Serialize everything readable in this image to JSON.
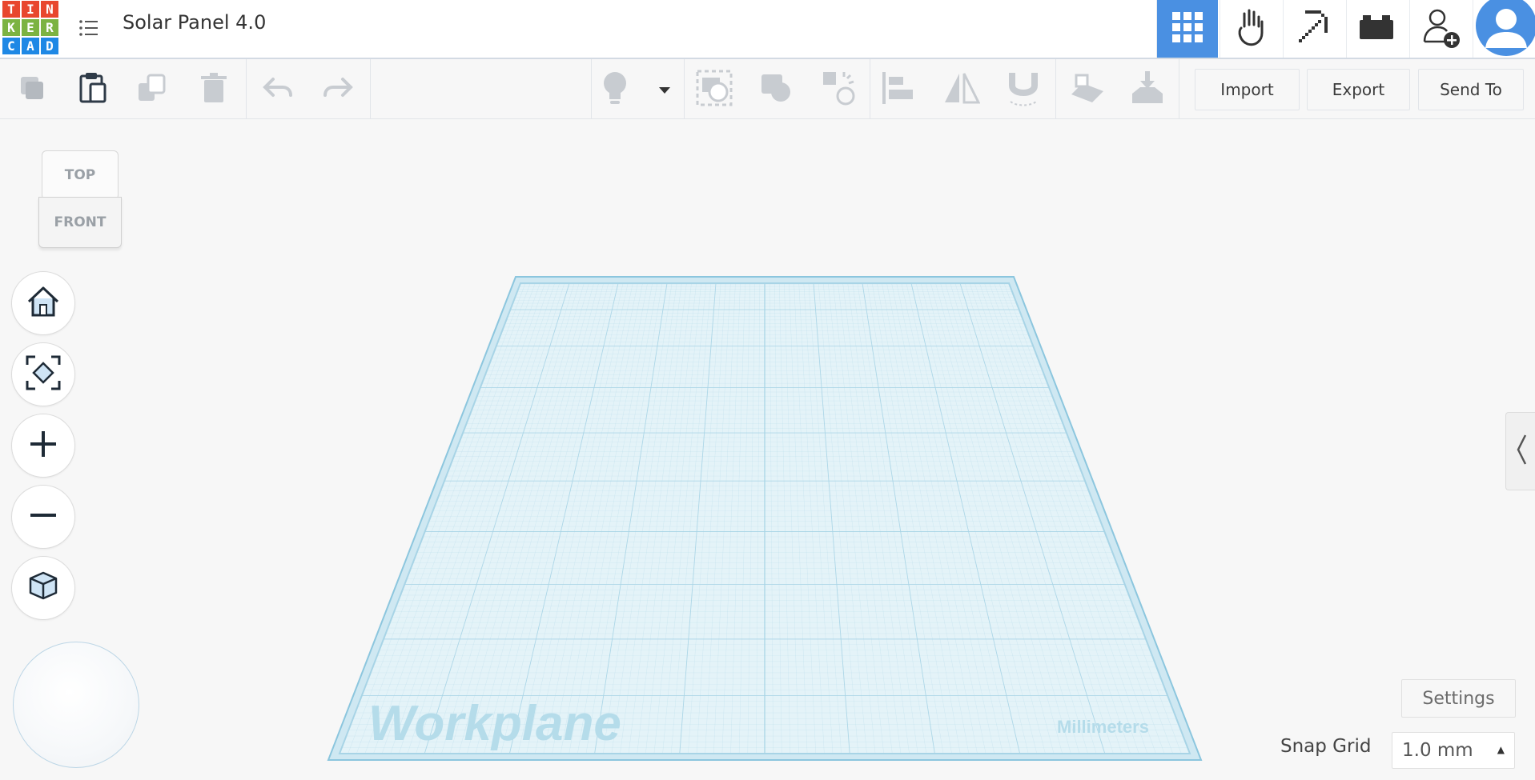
{
  "app": {
    "logo_letters": [
      "T",
      "I",
      "N",
      "K",
      "E",
      "R",
      "C",
      "A",
      "D"
    ],
    "logo_colors": [
      "#e8472e",
      "#e8472e",
      "#e8472e",
      "#7cb342",
      "#7cb342",
      "#7cb342",
      "#1e88e5",
      "#1e88e5",
      "#1e88e5"
    ],
    "design_title": "Solar Panel 4.0"
  },
  "header": {
    "buttons": [
      {
        "name": "3d-design-view",
        "icon": "grid-icon",
        "active": true
      },
      {
        "name": "circuits-view",
        "icon": "hand-icon",
        "active": false
      },
      {
        "name": "minecraft-view",
        "icon": "pickaxe-icon",
        "active": false
      },
      {
        "name": "bricks-view",
        "icon": "brick-icon",
        "active": false
      },
      {
        "name": "invite-collaborators",
        "icon": "add-user-icon",
        "active": false
      },
      {
        "name": "user-profile",
        "icon": "avatar-icon",
        "active": false
      }
    ],
    "accent": "#4a90e2"
  },
  "toolbar": {
    "import_label": "Import",
    "export_label": "Export",
    "send_to_label": "Send To"
  },
  "viewcube": {
    "top_label": "TOP",
    "front_label": "FRONT"
  },
  "workplane": {
    "label": "Workplane",
    "units_label": "Millimeters",
    "grid_color": "#a8d4e6"
  },
  "bottom_right": {
    "settings_label": "Settings",
    "snap_grid_label": "Snap Grid",
    "snap_grid_value": "1.0 mm"
  }
}
